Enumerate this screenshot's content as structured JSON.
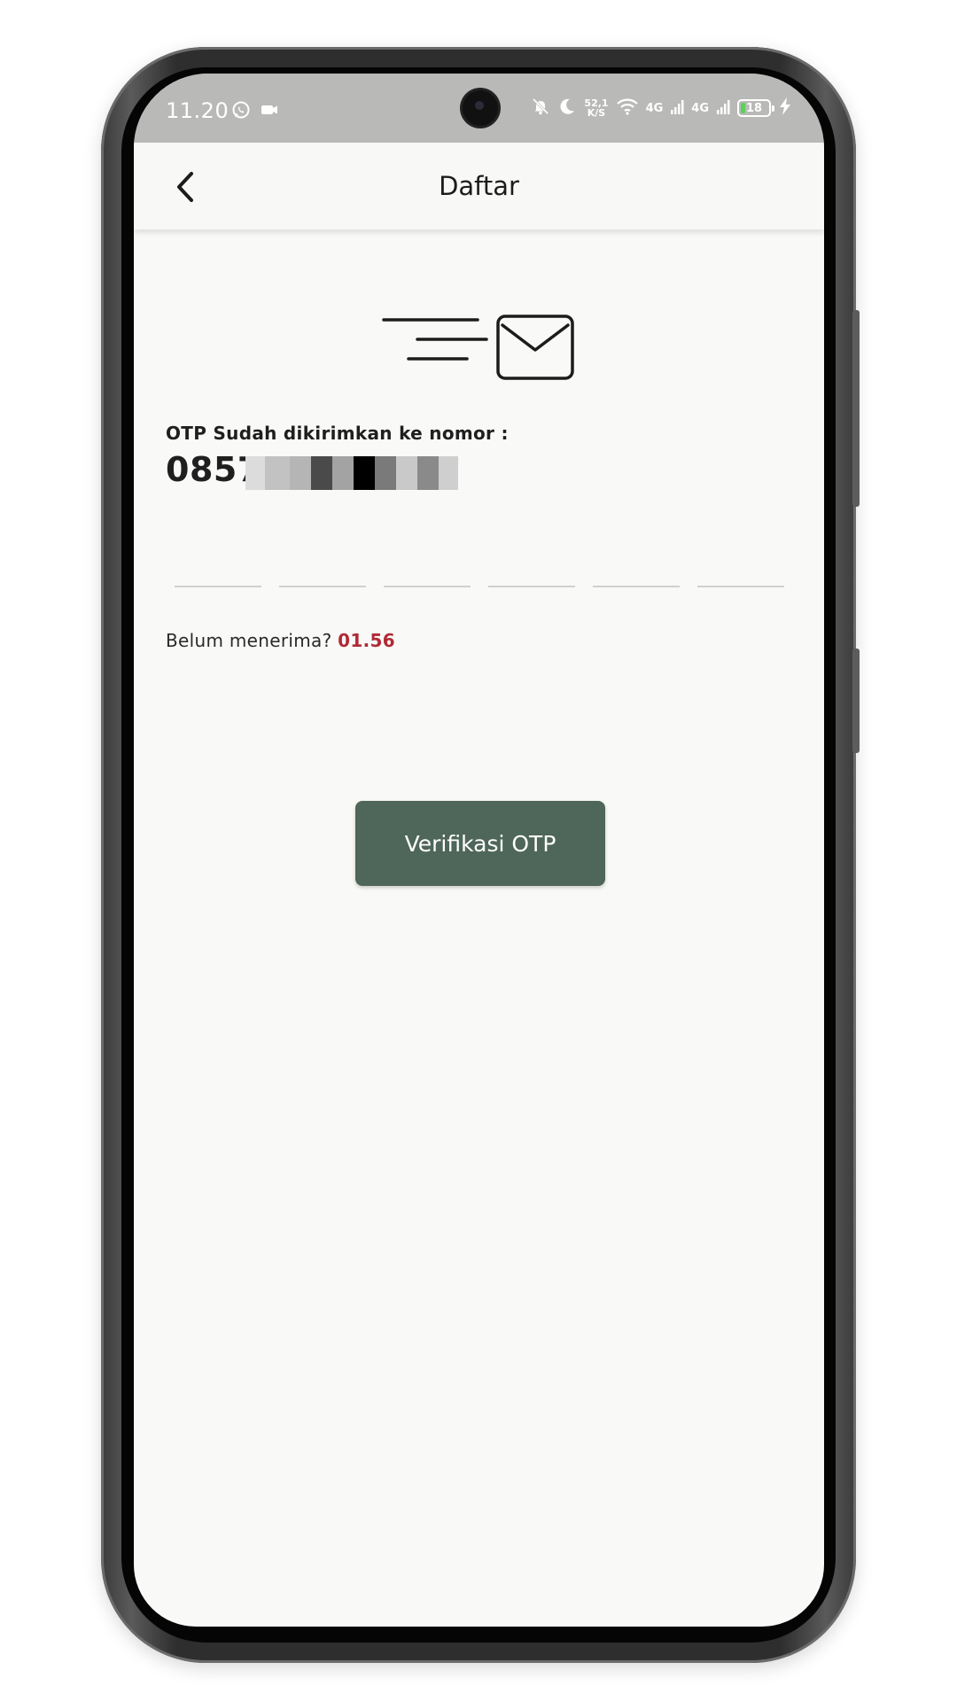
{
  "status_bar": {
    "time": "11.20",
    "net_speed_value": "52,1",
    "net_speed_unit": "K/S",
    "network_gen_1": "4G",
    "network_gen_2": "4G",
    "battery_level": "18",
    "battery_fraction": 0.18,
    "icons_left": [
      "whatsapp-icon",
      "video-camera-icon"
    ],
    "icons_right": [
      "muted-bell-icon",
      "moon-icon",
      "wifi-icon",
      "signal-icon",
      "signal-icon",
      "battery-icon",
      "charging-bolt-icon"
    ]
  },
  "app_bar": {
    "title": "Daftar",
    "back_icon": "chevron-left-icon"
  },
  "hero": {
    "icon": "sending-mail-icon"
  },
  "otp": {
    "caption": "OTP Sudah dikirimkan ke nomor :",
    "phone_visible": "0857",
    "digit_count": 6
  },
  "resend": {
    "label": "Belum menerima?",
    "timer": "01.56"
  },
  "actions": {
    "verify_label": "Verifikasi OTP"
  },
  "colors": {
    "accent_button": "#4f665a",
    "timer_red": "#b02a37",
    "background": "#f9faf7",
    "status_bar": "#b9bab8"
  }
}
